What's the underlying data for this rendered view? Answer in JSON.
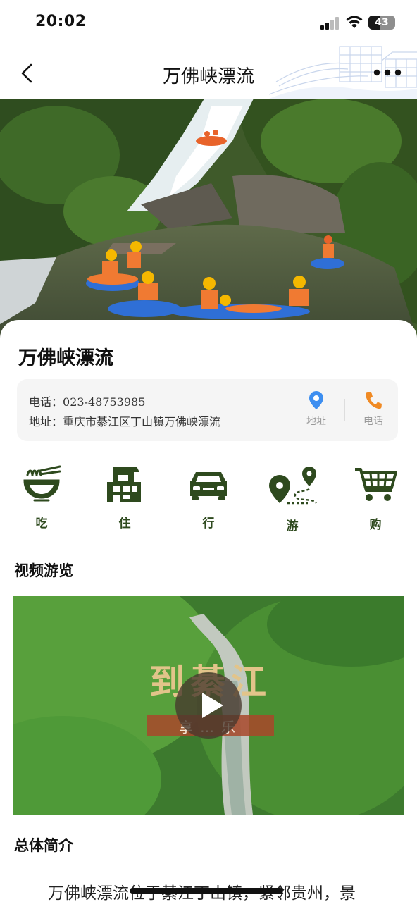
{
  "status_bar": {
    "time": "20:02",
    "battery": "43",
    "battery_level": 0.43
  },
  "nav": {
    "title": "万佛峡漂流"
  },
  "place": {
    "name": "万佛峡漂流",
    "phone_label": "电话：",
    "phone": "023-48753985",
    "address_label": "地址：",
    "address": "重庆市綦江区丁山镇万佛峡漂流",
    "address_action": "地址",
    "phone_action": "电话"
  },
  "categories": [
    {
      "label": "吃",
      "icon": "noodle-bowl-icon"
    },
    {
      "label": "住",
      "icon": "building-icon"
    },
    {
      "label": "行",
      "icon": "car-icon"
    },
    {
      "label": "游",
      "icon": "route-pin-icon"
    },
    {
      "label": "购",
      "icon": "shopping-cart-icon"
    }
  ],
  "video_section": {
    "title": "视频游览",
    "overlay_title": "到綦江",
    "overlay_subtitle": "享…乐"
  },
  "intro_section": {
    "title": "总体简介",
    "text": "万佛峡漂流位于綦江丁山镇，紧邻贵州，景"
  },
  "colors": {
    "accent_green": "#2e4a1e",
    "pin_blue": "#3d8ef0",
    "phone_orange": "#f08a24"
  }
}
